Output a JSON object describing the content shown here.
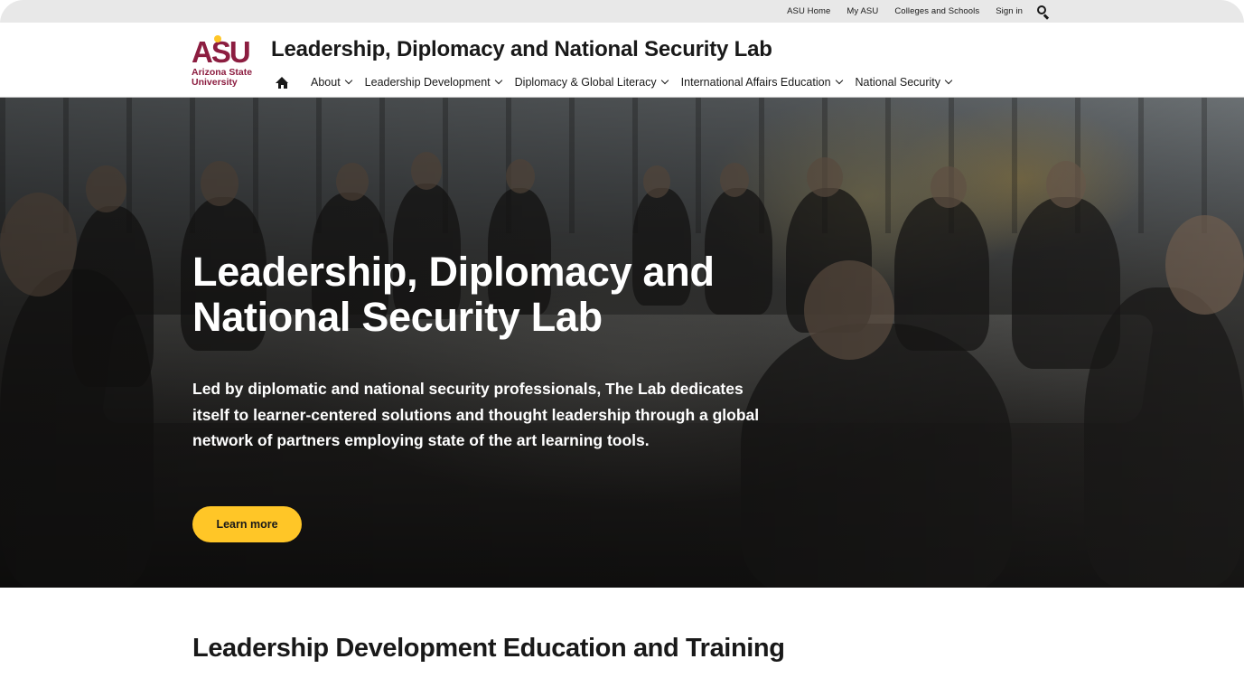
{
  "utility_nav": {
    "links": [
      "ASU Home",
      "My ASU",
      "Colleges and Schools",
      "Sign in"
    ],
    "search_icon": "search-icon"
  },
  "header": {
    "logo": {
      "mark": "ASU",
      "line1": "Arizona State",
      "line2": "University"
    },
    "title": "Leadership, Diplomacy and National Security Lab",
    "home_icon": "home-icon",
    "nav": [
      {
        "label": "About"
      },
      {
        "label": "Leadership Development"
      },
      {
        "label": "Diplomacy & Global Literacy"
      },
      {
        "label": "International Affairs Education"
      },
      {
        "label": "National Security"
      }
    ]
  },
  "hero": {
    "title": "Leadership, Diplomacy and National Security Lab",
    "text": "Led by diplomatic and national security professionals, The Lab dedicates itself to learner-centered solutions and thought leadership through a global network of partners employing state of the art learning tools.",
    "button_label": "Learn more"
  },
  "section": {
    "heading": "Leadership Development Education and Training"
  },
  "colors": {
    "brand_maroon": "#8c1d40",
    "brand_gold": "#ffc627",
    "text_dark": "#191919",
    "utility_bg": "#e8e8e8"
  }
}
